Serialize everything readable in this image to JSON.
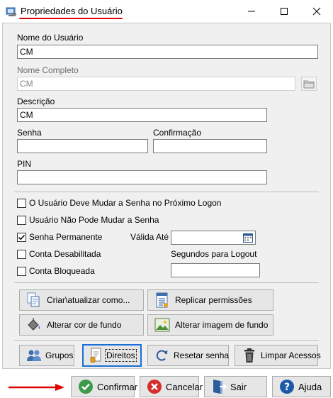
{
  "window": {
    "title": "Propriedades do Usuário"
  },
  "fields": {
    "nome_usuario": {
      "label": "Nome do Usuário",
      "value": "CM"
    },
    "nome_completo": {
      "label": "Nome Completo",
      "value": "CM"
    },
    "descricao": {
      "label": "Descrição",
      "value": "CM"
    },
    "senha": {
      "label": "Senha",
      "value": ""
    },
    "confirmacao": {
      "label": "Confirmação",
      "value": ""
    },
    "pin": {
      "label": "PIN",
      "value": ""
    },
    "valida_ate": {
      "label": "Válida Até",
      "value": ""
    },
    "segundos_logout": {
      "label": "Segundos para Logout",
      "value": ""
    }
  },
  "checkboxes": [
    {
      "label": "O Usuário Deve Mudar a Senha no Próximo Logon",
      "checked": false
    },
    {
      "label": "Usuário Não Pode Mudar a Senha",
      "checked": false
    },
    {
      "label": "Senha Permanente",
      "checked": true
    },
    {
      "label": "Conta Desabilitada",
      "checked": false
    },
    {
      "label": "Conta Bloqueada",
      "checked": false
    }
  ],
  "action_buttons": {
    "criar": "Criar\\atualizar como...",
    "replicar": "Replicar permissões",
    "alterar_cor": "Alterar cor de fundo",
    "alterar_imagem": "Alterar imagem de fundo"
  },
  "lower_buttons": {
    "grupos": "Grupos",
    "direitos": "Direitos",
    "resetar": "Resetar senha",
    "limpar": "Limpar Acessos"
  },
  "bottom_buttons": {
    "confirmar": "Confirmar",
    "cancelar": "Cancelar",
    "sair": "Sair",
    "ajuda": "Ajuda"
  },
  "colors": {
    "highlight_red": "#e00000",
    "focus_blue": "#1a6fd6",
    "confirm_green": "#3d9a4a",
    "cancel_red": "#d32f2f",
    "help_blue": "#1e5aa8"
  }
}
